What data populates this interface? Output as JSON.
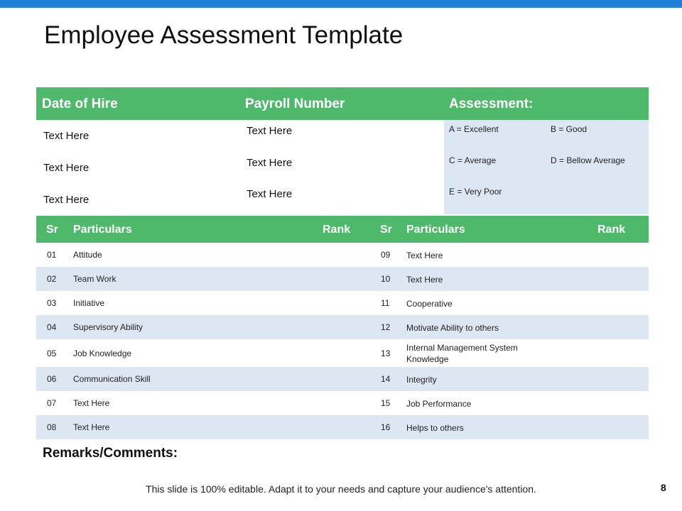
{
  "slide": {
    "title": "Employee Assessment Template",
    "accent_color": "#1f7fd6",
    "header_color": "#4eb96a",
    "row_alt_color": "#dde7f3",
    "page_number": "8",
    "footer": "This slide is 100% editable. Adapt it to your needs and capture your audience's attention."
  },
  "upper_table": {
    "headers": [
      "Date of Hire",
      "Payroll Number",
      "Assessment:"
    ],
    "date_of_hire": [
      "Text Here",
      "Text Here",
      "Text Here"
    ],
    "payroll_number": [
      "Text Here",
      "Text Here",
      "Text Here"
    ],
    "assessment_scale": [
      "A = Excellent",
      "B = Good",
      "C = Average",
      "D = Bellow Average",
      "E = Very Poor"
    ]
  },
  "lower_table": {
    "headers": [
      "Sr",
      "Particulars",
      "Rank",
      "Sr",
      "Particulars",
      "Rank"
    ],
    "rows": [
      {
        "sr1": "01",
        "p1": "Attitude",
        "sr2": "09",
        "p2": "Text Here"
      },
      {
        "sr1": "02",
        "p1": "Team Work",
        "sr2": "10",
        "p2": "Text Here"
      },
      {
        "sr1": "03",
        "p1": "Initiative",
        "sr2": "11",
        "p2": "Cooperative"
      },
      {
        "sr1": "04",
        "p1": "Supervisory Ability",
        "sr2": "12",
        "p2": "Motivate Ability to others"
      },
      {
        "sr1": "05",
        "p1": "Job Knowledge",
        "sr2": "13",
        "p2": "Internal Management System Knowledge"
      },
      {
        "sr1": "06",
        "p1": "Communication Skill",
        "sr2": "14",
        "p2": "Integrity"
      },
      {
        "sr1": "07",
        "p1": "Text Here",
        "sr2": "15",
        "p2": "Job Performance"
      },
      {
        "sr1": "08",
        "p1": "Text Here",
        "sr2": "16",
        "p2": "Helps to others"
      }
    ]
  },
  "remarks_label": "Remarks/Comments:"
}
